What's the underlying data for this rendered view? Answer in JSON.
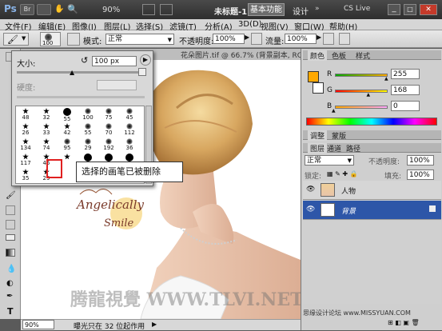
{
  "app": {
    "logo": "Ps",
    "zoom": "90%",
    "doc_title": "未标题-1",
    "workspace_active": "基本功能",
    "workspace_design": "设计",
    "cs_live": "CS Live"
  },
  "menu": [
    "文件(F)",
    "编辑(E)",
    "图像(I)",
    "图层(L)",
    "选择(S)",
    "滤镜(T)",
    "分析(A)",
    "3D(D)",
    "视图(V)",
    "窗口(W)",
    "帮助(H)"
  ],
  "options": {
    "brush_size": "100",
    "mode_label": "模式:",
    "mode_value": "正常",
    "opacity_label": "不透明度:",
    "opacity_value": "100%",
    "flow_label": "流量:",
    "flow_value": "100%"
  },
  "document": {
    "tab_title": "花朵图片.tif @ 66.7% (背景副本, RGB/8)"
  },
  "brush_picker": {
    "size_label": "大小:",
    "size_value": "100 px",
    "hardness_label": "硬度:",
    "cells": [
      {
        "label": "48",
        "shape": "leaf"
      },
      {
        "label": "32",
        "shape": "star"
      },
      {
        "label": "55",
        "shape": "dot"
      },
      {
        "label": "100",
        "shape": "fuzzy"
      },
      {
        "label": "75",
        "shape": "soft"
      },
      {
        "label": "45",
        "shape": "soft"
      },
      {
        "label": "26",
        "shape": "flower"
      },
      {
        "label": "33",
        "shape": "star"
      },
      {
        "label": "42",
        "shape": "star"
      },
      {
        "label": "55",
        "shape": "soft"
      },
      {
        "label": "70",
        "shape": "soft"
      },
      {
        "label": "112",
        "shape": "soft"
      },
      {
        "label": "134",
        "shape": "grass"
      },
      {
        "label": "74",
        "shape": "leaf"
      },
      {
        "label": "95",
        "shape": "soft"
      },
      {
        "label": "29",
        "shape": "soft"
      },
      {
        "label": "192",
        "shape": "soft"
      },
      {
        "label": "36",
        "shape": "soft"
      },
      {
        "label": "117",
        "shape": "flower"
      },
      {
        "label": "45",
        "shape": "star"
      },
      {
        "label": "",
        "shape": "maple"
      },
      {
        "label": "",
        "shape": "dot"
      },
      {
        "label": "",
        "shape": "dot"
      },
      {
        "label": "",
        "shape": "dot"
      },
      {
        "label": "35",
        "shape": "leaf"
      },
      {
        "label": "29",
        "shape": "butterfly"
      },
      {
        "label": "",
        "shape": "empty"
      }
    ]
  },
  "callout": {
    "text": "选择的画笔已被删除"
  },
  "watermark": {
    "logo_line1": "Angelically",
    "logo_line2": "Smile",
    "brand": "腾龍視覺 WWW.TLVI.NET",
    "forum": "思缘设计论坛 www.MISSYUAN.COM"
  },
  "status": {
    "zoom": "90%",
    "message": "曝光只在 32 位起作用"
  },
  "color_panel": {
    "tabs": [
      "颜色",
      "色板",
      "样式"
    ],
    "r_label": "R",
    "g_label": "G",
    "b_label": "B",
    "r_value": "255",
    "g_value": "168",
    "b_value": "0",
    "r_level": 1.0,
    "g_level": 0.66,
    "b_level": 0.0,
    "fg_color": "#ffa800"
  },
  "adjust_tabs": [
    "调整",
    "蒙版"
  ],
  "layers_panel": {
    "tabs": [
      "图层",
      "通道",
      "路径"
    ],
    "blend_mode": "正常",
    "opacity_label": "不透明度:",
    "opacity_value": "100%",
    "lock_label": "锁定:",
    "fill_label": "填充:",
    "fill_value": "100%",
    "layers": [
      {
        "name": "人物",
        "selected": false
      },
      {
        "name": "背景",
        "selected": true
      }
    ]
  }
}
